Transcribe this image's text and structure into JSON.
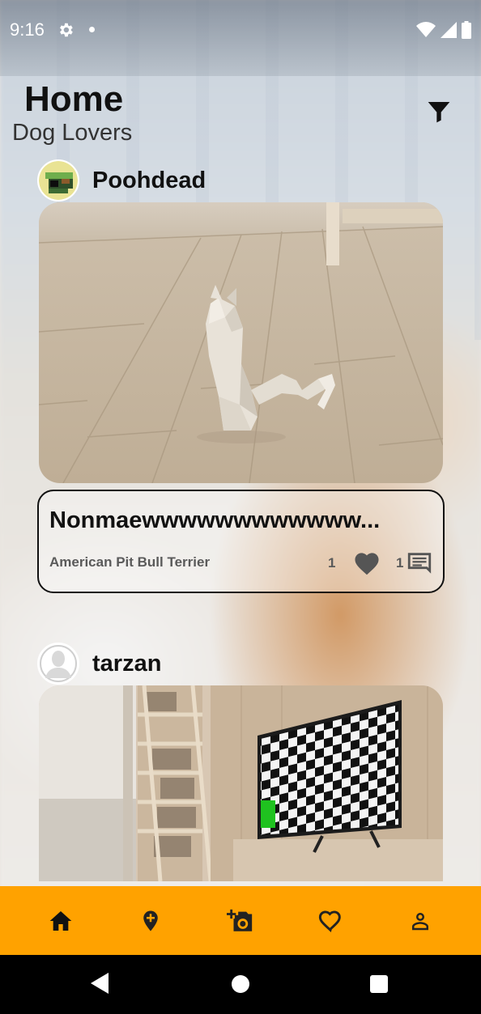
{
  "status_bar": {
    "time": "9:16"
  },
  "header": {
    "title": "Home",
    "subtitle": "Dog Lovers"
  },
  "posts": [
    {
      "username": "Poohdead",
      "pet_name": "Nonmaewwwwwwwwwwww...",
      "breed": "American Pit Bull Terrier",
      "likes": "1",
      "comments": "1"
    },
    {
      "username": "tarzan"
    }
  ],
  "colors": {
    "accent": "#ffa200",
    "nav_icon": "#111111"
  },
  "icons": {
    "filter": "filter-icon",
    "like": "heart-icon",
    "comment": "comment-icon",
    "nav": [
      "home-icon",
      "add-location-icon",
      "add-photo-icon",
      "favorite-icon",
      "profile-icon"
    ]
  }
}
